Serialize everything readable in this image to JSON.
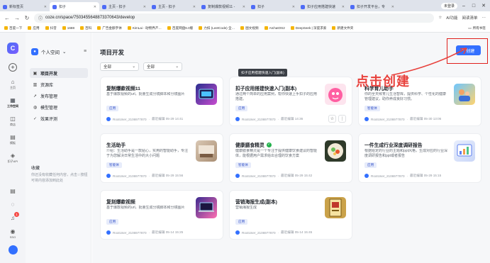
{
  "browser": {
    "tabs": [
      {
        "title": "新标签页",
        "active": false
      },
      {
        "title": "扣子",
        "active": true
      },
      {
        "title": "主页 - 扣子",
        "active": false
      },
      {
        "title": "主页 - 扣子",
        "active": false
      },
      {
        "title": "复制爆款视频11 -",
        "active": false
      },
      {
        "title": "扣子",
        "active": false
      },
      {
        "title": "扣子应用搭建快速",
        "active": false
      },
      {
        "title": "扣子开发平台，专",
        "active": false
      }
    ],
    "login_label": "未登录",
    "url": "coze.cn/space/7503455648873370643/develop",
    "ai_label": "AI功能",
    "reading_label": "阅读清单",
    "bookmarks": [
      "百度一下",
      "应用",
      "抖音",
      "1688",
      "百科",
      "广告金额字体",
      "KimLai - 动物界产…",
      "百度网盘6.0版",
      "力扣 (LeetCode) 全…",
      "图文视频",
      "AIchatOS2",
      "DeepSeek | 深度求索",
      "新建文件夹"
    ],
    "bookmarks_right": "所有书签"
  },
  "rail": {
    "logo_letter": "C",
    "items": [
      {
        "label": "主页",
        "icon": "home-icon",
        "glyph": "⌂"
      },
      {
        "label": "工作空间",
        "icon": "workspace-icon",
        "glyph": "▦"
      },
      {
        "label": "商店",
        "icon": "store-icon",
        "glyph": "◫"
      },
      {
        "label": "模板",
        "icon": "template-icon",
        "glyph": "▤"
      },
      {
        "label": "扣子API",
        "icon": "api-icon",
        "glyph": "◈"
      }
    ],
    "notif_count": "1",
    "sso_label": "SSO"
  },
  "space": {
    "name": "个人空间",
    "nav": [
      {
        "label": "项目开发",
        "icon": "project-icon",
        "glyph": "▣"
      },
      {
        "label": "资源库",
        "icon": "library-icon",
        "glyph": "▥"
      },
      {
        "label": "发布管理",
        "icon": "publish-icon",
        "glyph": "➚"
      },
      {
        "label": "模型管理",
        "icon": "model-icon",
        "glyph": "◍"
      },
      {
        "label": "效果评测",
        "icon": "evaluation-icon",
        "glyph": "✓"
      }
    ],
    "favorites_title": "收藏",
    "favorites_desc": "你还没有收藏任何内容，点击☆按钮可将内容添加到此处"
  },
  "main": {
    "title": "项目开发",
    "create_label": "创建",
    "filter1": "全部",
    "filter2": "全部",
    "tooltip": "扣子应用搭建快速入门(副本)",
    "annotation": "点击创建",
    "cards": [
      {
        "title": "复制爆款视频11",
        "desc": "基于爆款视频的url，批量生成分镜脚本和分镜图片",
        "badge": "应用",
        "owner": "RootUser_2106977870",
        "edited": "最近编辑 05-29 14:41"
      },
      {
        "title": "扣子应用搭建快速入门(副本)",
        "desc": "通过两个简单的应用案例，帮你快速上手扣子的应用搭建。",
        "badge": "应用",
        "owner": "RootUser_2106977870",
        "edited": "最近编辑 14:36"
      },
      {
        "title": "科学育儿助手",
        "desc": "你的全天候育儿生活智库，提供科学、个性化的健康管理建议，助你养成良好习惯。",
        "badge": "智能体",
        "owner": "RootUser_2106977870",
        "edited": "最近编辑 05-30 13:06"
      },
      {
        "title": "生活助手",
        "desc": "介绍：生活助手是一款贴心，实用的智能助手，专注于为您解决日常生活中的大小问题",
        "badge": "智能体",
        "owner": "RootUser_2106977870",
        "edited": "最近编辑 05-29 15:56"
      },
      {
        "title": "健康膳食精灵",
        "desc": "健康膳食精灵是一个专注于提供健康饮食建议的智能体，能根据用户需求给出合理的饮食方案",
        "badge": "智能体",
        "owner": "RootUser_2106977870",
        "edited": "最近编辑 05-29 15:42"
      },
      {
        "title": "一件生成行业深度调研报告",
        "desc": "根据给定的行业的主题和ppt风格，生成对应的行业深度调研报告和ppt或者报告",
        "badge": "应用",
        "owner": "RootUser_2106977870",
        "edited": "最近编辑 05-29 15:15"
      },
      {
        "title": "复刻爆款视频",
        "desc": "基于爆款视频的url，批量生成分镜脚本和分镜图片",
        "badge": "应用",
        "owner": "RootUser_2106977870",
        "edited": "最近编辑 05-14 15:25"
      },
      {
        "title": "营销海报生成(副本)",
        "desc": "营销海报生成",
        "badge": "应用",
        "owner": "RootUser_2106977870",
        "edited": "最近编辑 05-14 15:45"
      }
    ]
  },
  "colors": {
    "brand": "#3370ff",
    "annotation": "#e8423d",
    "verified": "#22b14c"
  }
}
